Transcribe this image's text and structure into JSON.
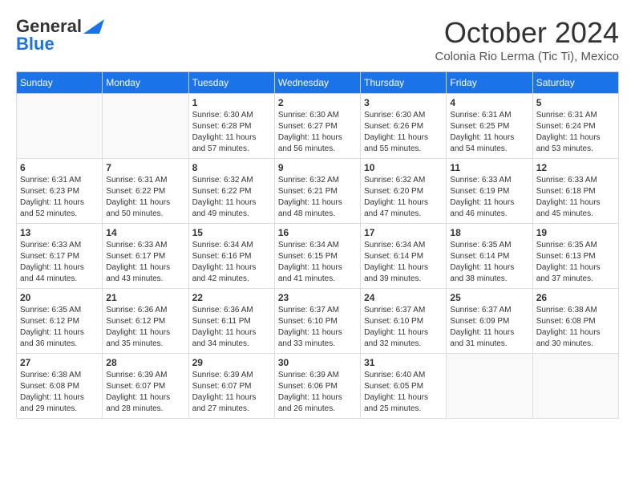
{
  "header": {
    "logo_general": "General",
    "logo_blue": "Blue",
    "month_title": "October 2024",
    "subtitle": "Colonia Rio Lerma (Tic Ti), Mexico"
  },
  "weekdays": [
    "Sunday",
    "Monday",
    "Tuesday",
    "Wednesday",
    "Thursday",
    "Friday",
    "Saturday"
  ],
  "weeks": [
    [
      {
        "day": "",
        "info": ""
      },
      {
        "day": "",
        "info": ""
      },
      {
        "day": "1",
        "info": "Sunrise: 6:30 AM\nSunset: 6:28 PM\nDaylight: 11 hours and 57 minutes."
      },
      {
        "day": "2",
        "info": "Sunrise: 6:30 AM\nSunset: 6:27 PM\nDaylight: 11 hours and 56 minutes."
      },
      {
        "day": "3",
        "info": "Sunrise: 6:30 AM\nSunset: 6:26 PM\nDaylight: 11 hours and 55 minutes."
      },
      {
        "day": "4",
        "info": "Sunrise: 6:31 AM\nSunset: 6:25 PM\nDaylight: 11 hours and 54 minutes."
      },
      {
        "day": "5",
        "info": "Sunrise: 6:31 AM\nSunset: 6:24 PM\nDaylight: 11 hours and 53 minutes."
      }
    ],
    [
      {
        "day": "6",
        "info": "Sunrise: 6:31 AM\nSunset: 6:23 PM\nDaylight: 11 hours and 52 minutes."
      },
      {
        "day": "7",
        "info": "Sunrise: 6:31 AM\nSunset: 6:22 PM\nDaylight: 11 hours and 50 minutes."
      },
      {
        "day": "8",
        "info": "Sunrise: 6:32 AM\nSunset: 6:22 PM\nDaylight: 11 hours and 49 minutes."
      },
      {
        "day": "9",
        "info": "Sunrise: 6:32 AM\nSunset: 6:21 PM\nDaylight: 11 hours and 48 minutes."
      },
      {
        "day": "10",
        "info": "Sunrise: 6:32 AM\nSunset: 6:20 PM\nDaylight: 11 hours and 47 minutes."
      },
      {
        "day": "11",
        "info": "Sunrise: 6:33 AM\nSunset: 6:19 PM\nDaylight: 11 hours and 46 minutes."
      },
      {
        "day": "12",
        "info": "Sunrise: 6:33 AM\nSunset: 6:18 PM\nDaylight: 11 hours and 45 minutes."
      }
    ],
    [
      {
        "day": "13",
        "info": "Sunrise: 6:33 AM\nSunset: 6:17 PM\nDaylight: 11 hours and 44 minutes."
      },
      {
        "day": "14",
        "info": "Sunrise: 6:33 AM\nSunset: 6:17 PM\nDaylight: 11 hours and 43 minutes."
      },
      {
        "day": "15",
        "info": "Sunrise: 6:34 AM\nSunset: 6:16 PM\nDaylight: 11 hours and 42 minutes."
      },
      {
        "day": "16",
        "info": "Sunrise: 6:34 AM\nSunset: 6:15 PM\nDaylight: 11 hours and 41 minutes."
      },
      {
        "day": "17",
        "info": "Sunrise: 6:34 AM\nSunset: 6:14 PM\nDaylight: 11 hours and 39 minutes."
      },
      {
        "day": "18",
        "info": "Sunrise: 6:35 AM\nSunset: 6:14 PM\nDaylight: 11 hours and 38 minutes."
      },
      {
        "day": "19",
        "info": "Sunrise: 6:35 AM\nSunset: 6:13 PM\nDaylight: 11 hours and 37 minutes."
      }
    ],
    [
      {
        "day": "20",
        "info": "Sunrise: 6:35 AM\nSunset: 6:12 PM\nDaylight: 11 hours and 36 minutes."
      },
      {
        "day": "21",
        "info": "Sunrise: 6:36 AM\nSunset: 6:12 PM\nDaylight: 11 hours and 35 minutes."
      },
      {
        "day": "22",
        "info": "Sunrise: 6:36 AM\nSunset: 6:11 PM\nDaylight: 11 hours and 34 minutes."
      },
      {
        "day": "23",
        "info": "Sunrise: 6:37 AM\nSunset: 6:10 PM\nDaylight: 11 hours and 33 minutes."
      },
      {
        "day": "24",
        "info": "Sunrise: 6:37 AM\nSunset: 6:10 PM\nDaylight: 11 hours and 32 minutes."
      },
      {
        "day": "25",
        "info": "Sunrise: 6:37 AM\nSunset: 6:09 PM\nDaylight: 11 hours and 31 minutes."
      },
      {
        "day": "26",
        "info": "Sunrise: 6:38 AM\nSunset: 6:08 PM\nDaylight: 11 hours and 30 minutes."
      }
    ],
    [
      {
        "day": "27",
        "info": "Sunrise: 6:38 AM\nSunset: 6:08 PM\nDaylight: 11 hours and 29 minutes."
      },
      {
        "day": "28",
        "info": "Sunrise: 6:39 AM\nSunset: 6:07 PM\nDaylight: 11 hours and 28 minutes."
      },
      {
        "day": "29",
        "info": "Sunrise: 6:39 AM\nSunset: 6:07 PM\nDaylight: 11 hours and 27 minutes."
      },
      {
        "day": "30",
        "info": "Sunrise: 6:39 AM\nSunset: 6:06 PM\nDaylight: 11 hours and 26 minutes."
      },
      {
        "day": "31",
        "info": "Sunrise: 6:40 AM\nSunset: 6:05 PM\nDaylight: 11 hours and 25 minutes."
      },
      {
        "day": "",
        "info": ""
      },
      {
        "day": "",
        "info": ""
      }
    ]
  ]
}
